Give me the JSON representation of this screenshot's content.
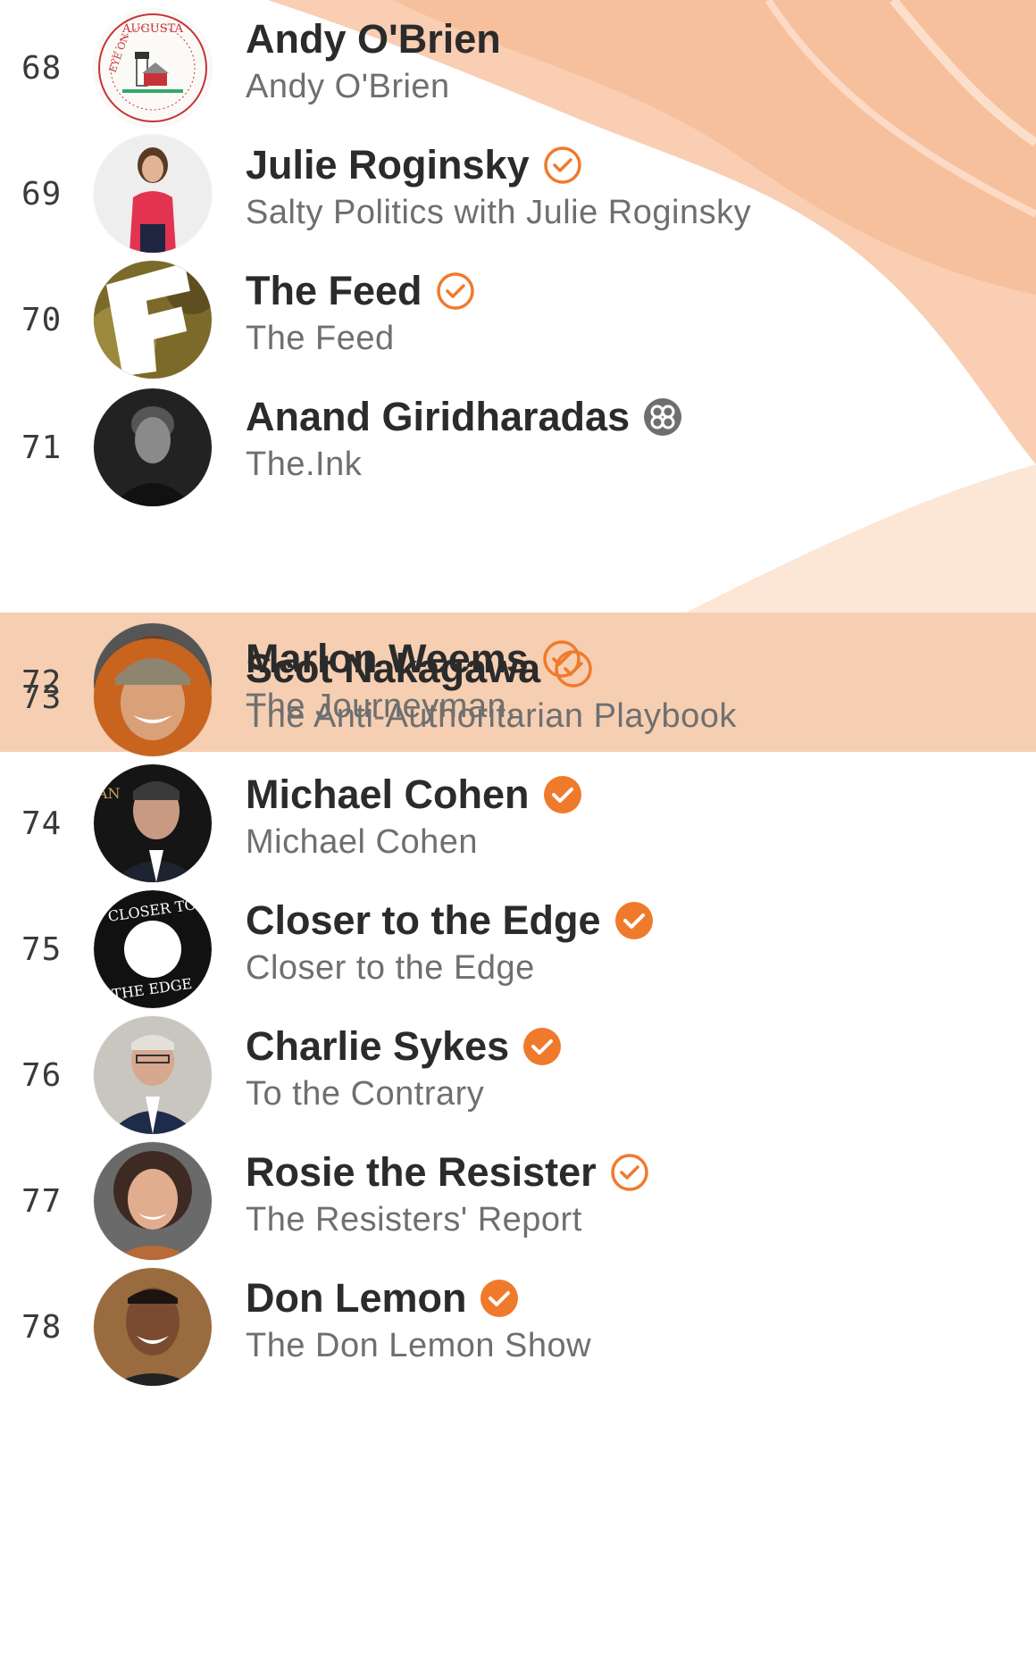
{
  "colors": {
    "accent": "#f07a2c",
    "highlight_row": "#f6cfb3",
    "name_text": "#2b2b2b",
    "publication_text": "#6f6f6f",
    "rank_text": "#3a3a3a"
  },
  "leaderboard": {
    "rows": [
      {
        "rank": "68",
        "name": "Andy O'Brien",
        "publication": "Andy O'Brien",
        "badge": "none",
        "avatar_icon": "eye-on-augusta-logo-icon",
        "avatar_text_top": "AUGUSTA",
        "avatar_text_left": "EYE ON",
        "highlighted": false
      },
      {
        "rank": "69",
        "name": "Julie Roginsky",
        "publication": "Salty Politics with Julie Roginsky",
        "badge": "outline",
        "avatar_icon": "woman-red-shirt-avatar-icon",
        "highlighted": false
      },
      {
        "rank": "70",
        "name": "The Feed",
        "publication": "The Feed",
        "badge": "outline",
        "avatar_icon": "the-feed-logo-icon",
        "highlighted": false
      },
      {
        "rank": "71",
        "name": "Anand Giridharadas",
        "publication": "The.Ink",
        "badge": "flower",
        "avatar_icon": "man-portrait-bw-avatar-icon",
        "highlighted": false
      },
      {
        "rank": "72",
        "name": "Marlon Weems",
        "publication": "The Journeyman.",
        "badge": "outline",
        "avatar_icon": "smiling-man-beard-avatar-icon",
        "highlighted": true
      },
      {
        "rank": "73",
        "name": "Scot Nakagawa",
        "publication": "The Anti-Authoritarian Playbook",
        "badge": "outline",
        "avatar_icon": "man-cap-avatar-icon",
        "highlighted": false
      },
      {
        "rank": "74",
        "name": "Michael Cohen",
        "publication": "Michael Cohen",
        "badge": "filled",
        "avatar_icon": "man-suit-avatar-icon",
        "highlighted": false
      },
      {
        "rank": "75",
        "name": "Closer to the Edge",
        "publication": "Closer to the Edge",
        "badge": "filled",
        "avatar_icon": "closer-to-the-edge-logo-icon",
        "avatar_text_top": "CLOSER TO",
        "avatar_text_bottom": "THE EDGE",
        "highlighted": false
      },
      {
        "rank": "76",
        "name": "Charlie Sykes",
        "publication": "To the Contrary",
        "badge": "filled",
        "avatar_icon": "man-glasses-suit-avatar-icon",
        "highlighted": false
      },
      {
        "rank": "77",
        "name": "Rosie the Resister",
        "publication": "The Resisters' Report",
        "badge": "outline",
        "avatar_icon": "woman-curly-hair-avatar-icon",
        "highlighted": false
      },
      {
        "rank": "78",
        "name": "Don Lemon",
        "publication": "The Don Lemon Show",
        "badge": "filled",
        "avatar_icon": "man-smiling-avatar-icon",
        "highlighted": false
      }
    ]
  }
}
